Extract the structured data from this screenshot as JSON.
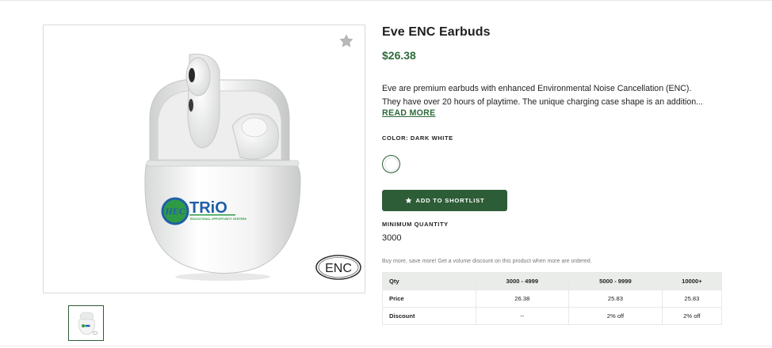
{
  "product": {
    "title": "Eve ENC Earbuds",
    "price": "$26.38",
    "description_line1": "Eve are premium earbuds with enhanced Environmental Noise Cancellation (ENC).",
    "description_line2": "They have over 20 hours of playtime. The unique charging case shape is an addition...",
    "read_more": "READ MORE",
    "color_label": "COLOR: DARK WHITE",
    "shortlist_button": "ADD TO SHORTLIST",
    "min_qty_label": "MINIMUM QUANTITY",
    "min_qty_value": "3000",
    "volume_note": "Buy more, save more! Get a volume discount on this product when more are ordered.",
    "image_logo_text": "TRiO",
    "image_logo_sub": "EDUCATIONAL OPPORTUNITY CENTERS",
    "image_badge": "ENC"
  },
  "pricing_table": {
    "headers": [
      "Qty",
      "3000 - 4999",
      "5000 - 9999",
      "10000+"
    ],
    "price_row": [
      "Price",
      "26.38",
      "25.83",
      "25.83"
    ],
    "discount_row": [
      "Discount",
      "--",
      "2% off",
      "2% off"
    ]
  },
  "icons": {
    "favorite": "star-icon",
    "shortlist": "star-icon"
  },
  "colors": {
    "accent": "#2d5d36",
    "price": "#2d6a3a",
    "table_header_bg": "#eaecea",
    "logo_blue": "#1f5fa8",
    "logo_green": "#2f9a46"
  }
}
